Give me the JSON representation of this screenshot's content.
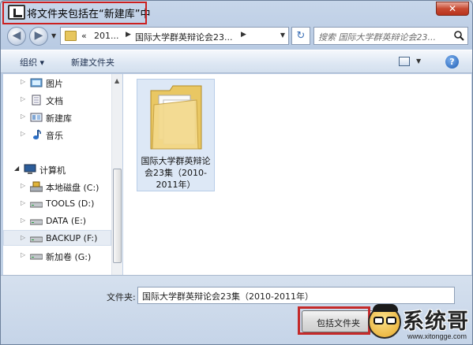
{
  "title_bar": {
    "title": "将文件夹包括在“新建库”中",
    "close_glyph": "✕"
  },
  "address_bar": {
    "overflow": "«",
    "crumbs": [
      "201...",
      "国际大学群英辩论会23..."
    ],
    "refresh_glyph": "↻",
    "search_placeholder": "搜索 国际大学群英辩论会23..."
  },
  "nav_buttons": {
    "back_glyph": "◀",
    "forward_glyph": "▶"
  },
  "command_bar": {
    "organize_label": "组织 ▾",
    "new_folder_label": "新建文件夹",
    "help_glyph": "?"
  },
  "nav_pane": {
    "items": [
      {
        "label": "图片",
        "icon": "pictures-icon"
      },
      {
        "label": "文档",
        "icon": "documents-icon"
      },
      {
        "label": "新建库",
        "icon": "library-icon"
      },
      {
        "label": "音乐",
        "icon": "music-icon"
      },
      {
        "label": "计算机",
        "icon": "computer-icon"
      },
      {
        "label": "本地磁盘 (C:)",
        "icon": "system-drive-icon"
      },
      {
        "label": "TOOLS (D:)",
        "icon": "drive-icon"
      },
      {
        "label": "DATA (E:)",
        "icon": "drive-icon"
      },
      {
        "label": "BACKUP (F:)",
        "icon": "drive-icon",
        "selected": true
      },
      {
        "label": "新加卷 (G:)",
        "icon": "drive-icon"
      }
    ]
  },
  "content": {
    "folder_name": "国际大学群英辩论会23集（2010-2011年）"
  },
  "bottom": {
    "folder_label": "文件夹:",
    "folder_value": "国际大学群英辩论会23集（2010-2011年）",
    "include_button": "包括文件夹"
  },
  "watermark": {
    "text": "系统哥",
    "url": "www.xitongge.com"
  },
  "colors": {
    "highlight_red": "#cc2020",
    "selection_blue": "#dde8f6"
  }
}
